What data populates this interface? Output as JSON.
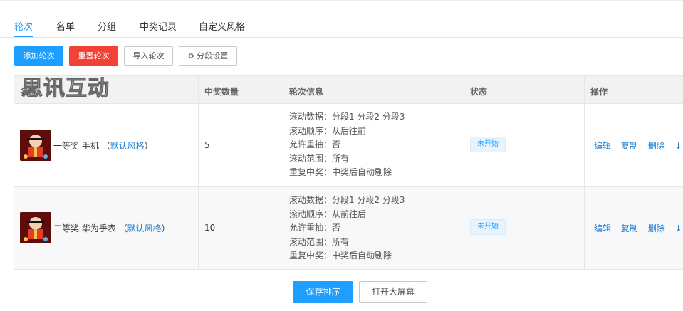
{
  "tabs": [
    {
      "label": "轮次",
      "active": true
    },
    {
      "label": "名单",
      "active": false
    },
    {
      "label": "分组",
      "active": false
    },
    {
      "label": "中奖记录",
      "active": false
    },
    {
      "label": "自定义风格",
      "active": false
    }
  ],
  "toolbar": {
    "add_label": "添加轮次",
    "reset_label": "重置轮次",
    "import_label": "导入轮次",
    "segment_label": "分段设置"
  },
  "watermark": "思讯互动",
  "table": {
    "headers": {
      "name": "名称",
      "count": "中奖数量",
      "info": "轮次信息",
      "status": "状态",
      "ops": "操作"
    },
    "rows": [
      {
        "name": "一等奖 手机",
        "style_open": "（",
        "style": "默认风格",
        "style_close": "）",
        "count": "5",
        "info": [
          "滚动数据：分段1 分段2 分段3",
          "滚动顺序：从后往前",
          "允许重抽：否",
          "滚动范围：所有",
          "重复中奖：中奖后自动剔除"
        ],
        "status": "未开始",
        "ops": {
          "edit": "编辑",
          "copy": "复制",
          "delete": "删除",
          "down": "↓",
          "up": "↑"
        }
      },
      {
        "name": "二等奖 华为手表",
        "style_open": "（",
        "style": "默认风格",
        "style_close": "）",
        "count": "10",
        "info": [
          "滚动数据：分段1 分段2 分段3",
          "滚动顺序：从前往后",
          "允许重抽：否",
          "滚动范围：所有",
          "重复中奖：中奖后自动剔除"
        ],
        "status": "未开始",
        "ops": {
          "edit": "编辑",
          "copy": "复制",
          "delete": "删除",
          "down": "↓",
          "up": "↑"
        }
      }
    ]
  },
  "footer": {
    "save_label": "保存排序",
    "screen_label": "打开大屏幕"
  },
  "colors": {
    "primary": "#1e9fff",
    "danger": "#f24236",
    "link": "#1e7fd3"
  }
}
